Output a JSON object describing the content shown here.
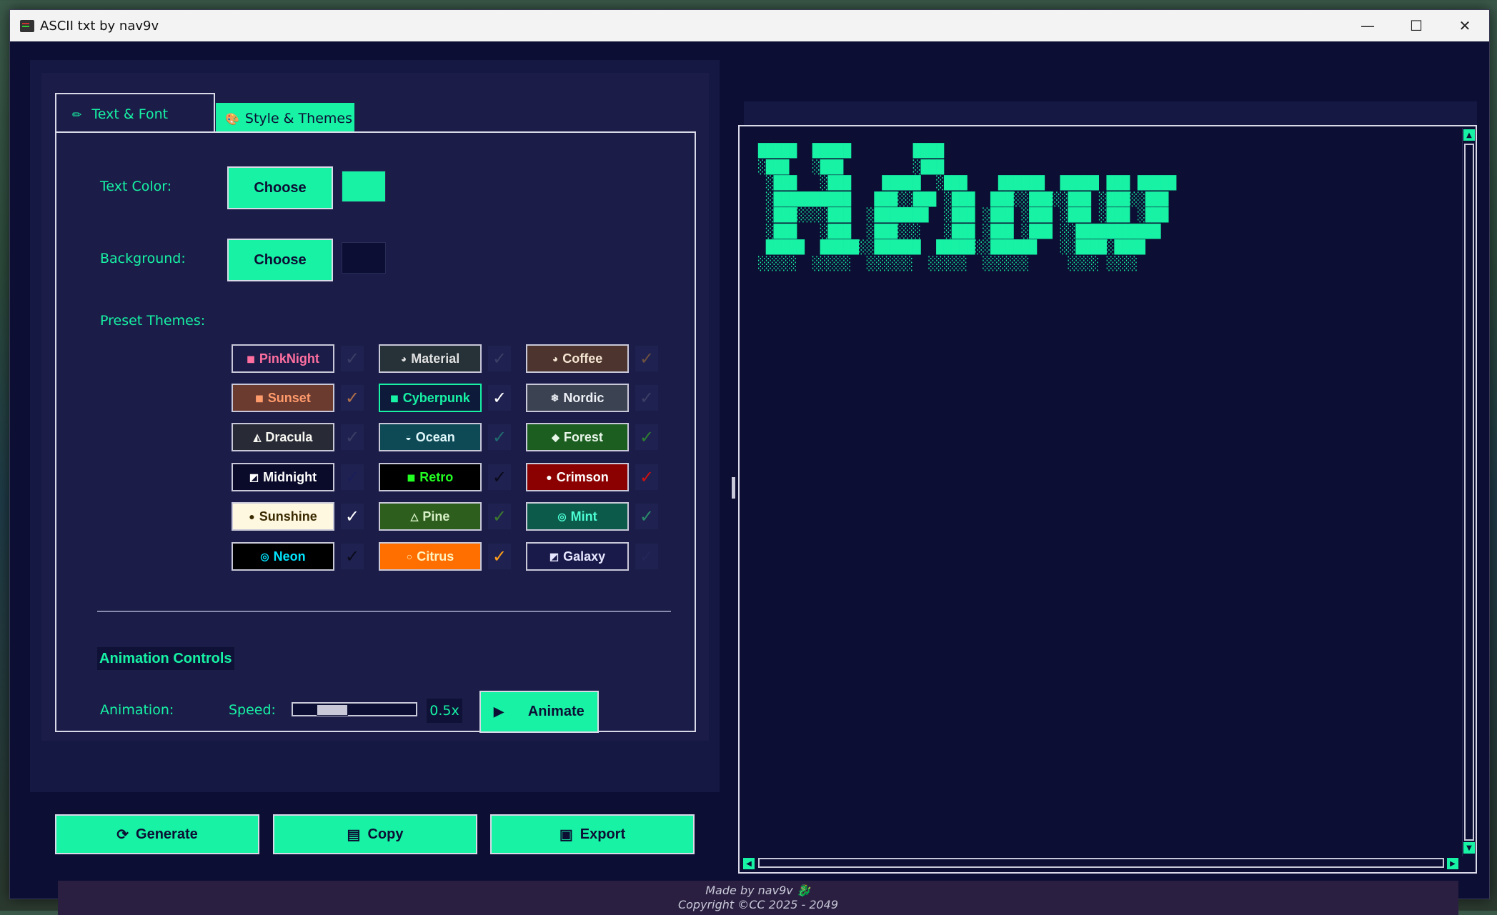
{
  "window": {
    "title": "ASCII txt by nav9v",
    "controls": {
      "minimize": "—",
      "maximize": "☐",
      "close": "✕"
    }
  },
  "tabs": [
    {
      "label": "Text & Font",
      "icon": "✏",
      "active": false
    },
    {
      "label": "Style & Themes",
      "icon": "🎨",
      "active": true
    }
  ],
  "style": {
    "text_color_label": "Text Color:",
    "background_label": "Background:",
    "choose_label": "Choose",
    "text_color": "#17f2a5",
    "background_color": "#0c0e33",
    "preset_label": "Preset Themes:"
  },
  "themes": [
    {
      "name": "PinkNight",
      "icon": "◼",
      "bg": "#1b1d48",
      "fg": "#ff6fa0",
      "check": "#3c3e66",
      "border": "#c8c8d8"
    },
    {
      "name": "Material",
      "icon": "◕",
      "bg": "#263238",
      "fg": "#e0e0e0",
      "check": "#3c3e66",
      "border": "#c8c8d8"
    },
    {
      "name": "Coffee",
      "icon": "◕",
      "bg": "#4e342e",
      "fg": "#f5e6d3",
      "check": "#6d5040",
      "border": "#c8c8d8"
    },
    {
      "name": "Sunset",
      "icon": "◼",
      "bg": "#6b3b30",
      "fg": "#ff9a6b",
      "check": "#b0704a",
      "border": "#c8c8d8"
    },
    {
      "name": "Cyberpunk",
      "icon": "◼",
      "bg": "#0e1a3a",
      "fg": "#17f2a5",
      "check": "#ffffff",
      "border": "#17f2a5"
    },
    {
      "name": "Nordic",
      "icon": "❄",
      "bg": "#3b4252",
      "fg": "#eceff4",
      "check": "#3c3e66",
      "border": "#c8c8d8"
    },
    {
      "name": "Dracula",
      "icon": "◭",
      "bg": "#282a36",
      "fg": "#f8f8f2",
      "check": "#3c3e66",
      "border": "#c8c8d8"
    },
    {
      "name": "Ocean",
      "icon": "◒",
      "bg": "#0e4a55",
      "fg": "#e0f7fa",
      "check": "#1f6b70",
      "border": "#c8c8d8"
    },
    {
      "name": "Forest",
      "icon": "◆",
      "bg": "#1b5e20",
      "fg": "#e8f5e9",
      "check": "#2e7d32",
      "border": "#c8c8d8"
    },
    {
      "name": "Midnight",
      "icon": "◩",
      "bg": "#0a0a2a",
      "fg": "#ffffff",
      "check": "#1a1d5a",
      "border": "#c8c8d8"
    },
    {
      "name": "Retro",
      "icon": "◼",
      "bg": "#000000",
      "fg": "#22ff22",
      "check": "#0a0a1a",
      "border": "#c8c8d8"
    },
    {
      "name": "Crimson",
      "icon": "●",
      "bg": "#8b0000",
      "fg": "#ffffff",
      "check": "#cc1111",
      "border": "#c8c8d8"
    },
    {
      "name": "Sunshine",
      "icon": "●",
      "bg": "#fff8e1",
      "fg": "#3a2a00",
      "check": "#ffffff",
      "border": "#c8c8d8"
    },
    {
      "name": "Pine",
      "icon": "△",
      "bg": "#2e5e1e",
      "fg": "#d8f0c8",
      "check": "#3c7a2e",
      "border": "#c8c8d8"
    },
    {
      "name": "Mint",
      "icon": "◎",
      "bg": "#0b5a4a",
      "fg": "#4dffd6",
      "check": "#2a8a6a",
      "border": "#c8c8d8"
    },
    {
      "name": "Neon",
      "icon": "◎",
      "bg": "#000000",
      "fg": "#00e5ff",
      "check": "#0a0a1a",
      "border": "#c8c8d8"
    },
    {
      "name": "Citrus",
      "icon": "○",
      "bg": "#ff6f00",
      "fg": "#fff3c0",
      "check": "#ff9f1c",
      "border": "#c8c8d8"
    },
    {
      "name": "Galaxy",
      "icon": "◩",
      "bg": "#1a1a4a",
      "fg": "#e6e6ff",
      "check": "#24265a",
      "border": "#c8c8d8"
    }
  ],
  "animation": {
    "section_title": "Animation Controls",
    "label": "Animation:",
    "speed_label": "Speed:",
    "speed_value": "0.5x",
    "speed_fraction": 0.25,
    "button_label": "Animate",
    "button_icon": "▶"
  },
  "actions": [
    {
      "label": "Generate",
      "icon": "⟳"
    },
    {
      "label": "Copy",
      "icon": "▤"
    },
    {
      "label": "Export",
      "icon": "▣"
    }
  ],
  "ascii_art": "█████  █████        ████\n░███   ░███         ░███\n ░███   ░███    █████  ░███    ██████  █████ ███ █████\n ░██████████   ███░░███ ░███  ███░░███░░███ ░███░░███\n ░███░░░░███  ░███████  ░███ ░███ ░███ ░███ ░███ ░███\n ░███   ░███  ░███░░░   ░███ ░███ ░███ ░░███████████\n █████  █████░░██████  █████░░██████   ░░████░████\n░░░░░  ░░░░░  ░░░░░░  ░░░░░  ░░░░░░     ░░░░ ░░░░",
  "footer": {
    "line1": "Made by nav9v 🐉",
    "line2": "Copyright ©CC 2025 - 2049"
  }
}
